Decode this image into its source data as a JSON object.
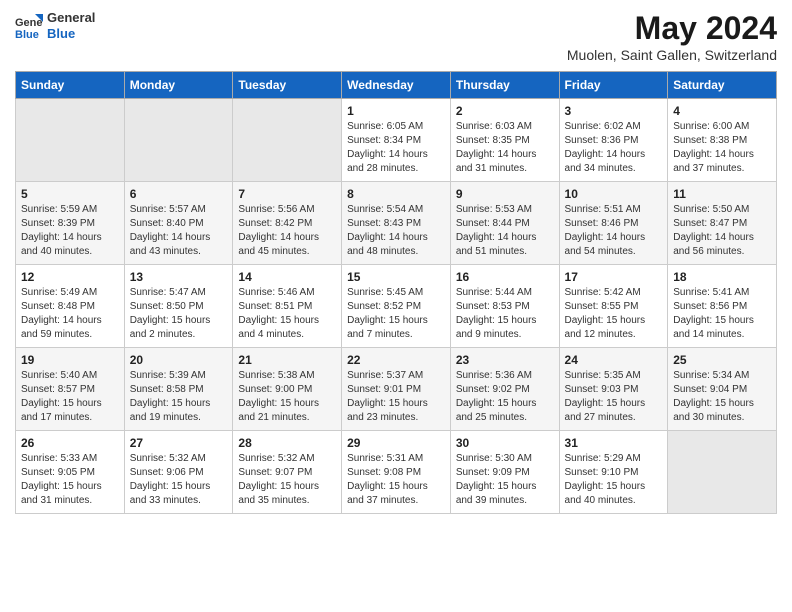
{
  "logo": {
    "line1": "General",
    "line2": "Blue"
  },
  "title": "May 2024",
  "subtitle": "Muolen, Saint Gallen, Switzerland",
  "days_of_week": [
    "Sunday",
    "Monday",
    "Tuesday",
    "Wednesday",
    "Thursday",
    "Friday",
    "Saturday"
  ],
  "weeks": [
    [
      {
        "day": "",
        "info": ""
      },
      {
        "day": "",
        "info": ""
      },
      {
        "day": "",
        "info": ""
      },
      {
        "day": "1",
        "info": "Sunrise: 6:05 AM\nSunset: 8:34 PM\nDaylight: 14 hours\nand 28 minutes."
      },
      {
        "day": "2",
        "info": "Sunrise: 6:03 AM\nSunset: 8:35 PM\nDaylight: 14 hours\nand 31 minutes."
      },
      {
        "day": "3",
        "info": "Sunrise: 6:02 AM\nSunset: 8:36 PM\nDaylight: 14 hours\nand 34 minutes."
      },
      {
        "day": "4",
        "info": "Sunrise: 6:00 AM\nSunset: 8:38 PM\nDaylight: 14 hours\nand 37 minutes."
      }
    ],
    [
      {
        "day": "5",
        "info": "Sunrise: 5:59 AM\nSunset: 8:39 PM\nDaylight: 14 hours\nand 40 minutes."
      },
      {
        "day": "6",
        "info": "Sunrise: 5:57 AM\nSunset: 8:40 PM\nDaylight: 14 hours\nand 43 minutes."
      },
      {
        "day": "7",
        "info": "Sunrise: 5:56 AM\nSunset: 8:42 PM\nDaylight: 14 hours\nand 45 minutes."
      },
      {
        "day": "8",
        "info": "Sunrise: 5:54 AM\nSunset: 8:43 PM\nDaylight: 14 hours\nand 48 minutes."
      },
      {
        "day": "9",
        "info": "Sunrise: 5:53 AM\nSunset: 8:44 PM\nDaylight: 14 hours\nand 51 minutes."
      },
      {
        "day": "10",
        "info": "Sunrise: 5:51 AM\nSunset: 8:46 PM\nDaylight: 14 hours\nand 54 minutes."
      },
      {
        "day": "11",
        "info": "Sunrise: 5:50 AM\nSunset: 8:47 PM\nDaylight: 14 hours\nand 56 minutes."
      }
    ],
    [
      {
        "day": "12",
        "info": "Sunrise: 5:49 AM\nSunset: 8:48 PM\nDaylight: 14 hours\nand 59 minutes."
      },
      {
        "day": "13",
        "info": "Sunrise: 5:47 AM\nSunset: 8:50 PM\nDaylight: 15 hours\nand 2 minutes."
      },
      {
        "day": "14",
        "info": "Sunrise: 5:46 AM\nSunset: 8:51 PM\nDaylight: 15 hours\nand 4 minutes."
      },
      {
        "day": "15",
        "info": "Sunrise: 5:45 AM\nSunset: 8:52 PM\nDaylight: 15 hours\nand 7 minutes."
      },
      {
        "day": "16",
        "info": "Sunrise: 5:44 AM\nSunset: 8:53 PM\nDaylight: 15 hours\nand 9 minutes."
      },
      {
        "day": "17",
        "info": "Sunrise: 5:42 AM\nSunset: 8:55 PM\nDaylight: 15 hours\nand 12 minutes."
      },
      {
        "day": "18",
        "info": "Sunrise: 5:41 AM\nSunset: 8:56 PM\nDaylight: 15 hours\nand 14 minutes."
      }
    ],
    [
      {
        "day": "19",
        "info": "Sunrise: 5:40 AM\nSunset: 8:57 PM\nDaylight: 15 hours\nand 17 minutes."
      },
      {
        "day": "20",
        "info": "Sunrise: 5:39 AM\nSunset: 8:58 PM\nDaylight: 15 hours\nand 19 minutes."
      },
      {
        "day": "21",
        "info": "Sunrise: 5:38 AM\nSunset: 9:00 PM\nDaylight: 15 hours\nand 21 minutes."
      },
      {
        "day": "22",
        "info": "Sunrise: 5:37 AM\nSunset: 9:01 PM\nDaylight: 15 hours\nand 23 minutes."
      },
      {
        "day": "23",
        "info": "Sunrise: 5:36 AM\nSunset: 9:02 PM\nDaylight: 15 hours\nand 25 minutes."
      },
      {
        "day": "24",
        "info": "Sunrise: 5:35 AM\nSunset: 9:03 PM\nDaylight: 15 hours\nand 27 minutes."
      },
      {
        "day": "25",
        "info": "Sunrise: 5:34 AM\nSunset: 9:04 PM\nDaylight: 15 hours\nand 30 minutes."
      }
    ],
    [
      {
        "day": "26",
        "info": "Sunrise: 5:33 AM\nSunset: 9:05 PM\nDaylight: 15 hours\nand 31 minutes."
      },
      {
        "day": "27",
        "info": "Sunrise: 5:32 AM\nSunset: 9:06 PM\nDaylight: 15 hours\nand 33 minutes."
      },
      {
        "day": "28",
        "info": "Sunrise: 5:32 AM\nSunset: 9:07 PM\nDaylight: 15 hours\nand 35 minutes."
      },
      {
        "day": "29",
        "info": "Sunrise: 5:31 AM\nSunset: 9:08 PM\nDaylight: 15 hours\nand 37 minutes."
      },
      {
        "day": "30",
        "info": "Sunrise: 5:30 AM\nSunset: 9:09 PM\nDaylight: 15 hours\nand 39 minutes."
      },
      {
        "day": "31",
        "info": "Sunrise: 5:29 AM\nSunset: 9:10 PM\nDaylight: 15 hours\nand 40 minutes."
      },
      {
        "day": "",
        "info": ""
      }
    ]
  ]
}
